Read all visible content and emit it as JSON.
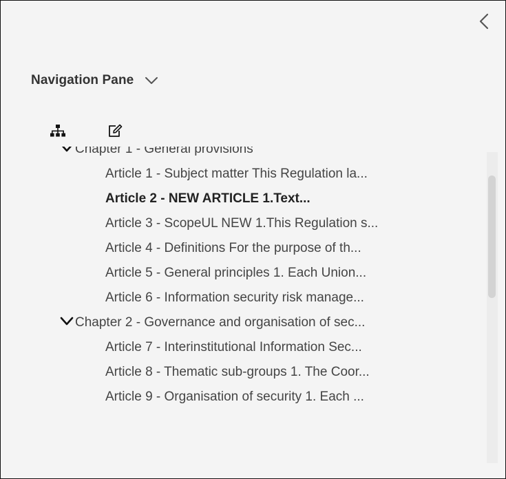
{
  "pane": {
    "title": "Navigation Pane"
  },
  "icons": {
    "collapse": "chevron-left-icon",
    "pane_dropdown": "chevron-down-icon",
    "structure_view": "sitemap-icon",
    "edit_view": "edit-icon",
    "chapter_expanded": "chevron-down-icon"
  },
  "tree": {
    "chapters": [
      {
        "label": "Chapter 1 - General provisions",
        "expanded": true,
        "articles": [
          {
            "label": "Article 1 - Subject matter This Regulation la...",
            "bold": false
          },
          {
            "label": "Article 2 - NEW ARTICLE 1.Text...",
            "bold": true
          },
          {
            "label": "Article 3 - ScopeUL NEW 1.This Regulation s...",
            "bold": false
          },
          {
            "label": "Article 4 - Definitions For the purpose of th...",
            "bold": false
          },
          {
            "label": "Article 5 - General principles  1. Each Union...",
            "bold": false
          },
          {
            "label": "Article 6 - Information security risk manage...",
            "bold": false
          }
        ]
      },
      {
        "label": "Chapter 2 - Governance and organisation of sec...",
        "expanded": true,
        "articles": [
          {
            "label": "Article 7 - Interinstitutional Information Sec...",
            "bold": false
          },
          {
            "label": "Article 8 - Thematic sub-groups 1. The Coor...",
            "bold": false
          },
          {
            "label": "Article 9 - Organisation of security 1. Each ...",
            "bold": false
          }
        ]
      }
    ]
  },
  "colors": {
    "pane_background": "#f4f4f4",
    "text": "#444444",
    "bold_text": "#222222",
    "scrollbar_track": "#ececec",
    "scrollbar_thumb": "#d3d3d3"
  }
}
